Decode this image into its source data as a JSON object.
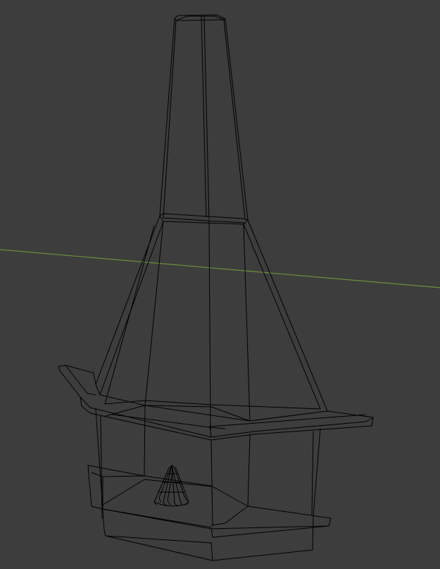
{
  "viewport": {
    "background_color": "#3d3d3d",
    "wire_color": "#000000",
    "x_axis_color": "#6e8f3a",
    "display_mode": "wireframe",
    "object": "fireplace"
  }
}
